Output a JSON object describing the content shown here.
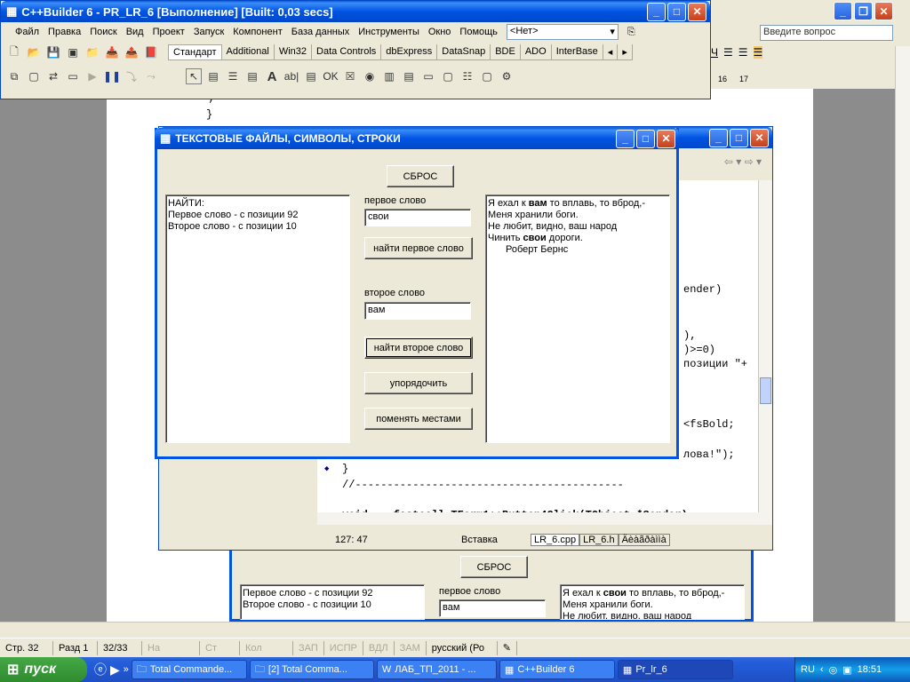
{
  "builder": {
    "title": "C++Builder 6 - PR_LR_6 [Выполнение] [Built: 0,03 secs]",
    "menu": [
      "Файл",
      "Правка",
      "Поиск",
      "Вид",
      "Проект",
      "Запуск",
      "Компонент",
      "База данных",
      "Инструменты",
      "Окно",
      "Помощь"
    ],
    "combo_value": "<Нет>",
    "palette_tabs": [
      "Стандарт",
      "Additional",
      "Win32",
      "Data Controls",
      "dbExpress",
      "DataSnap",
      "BDE",
      "ADO",
      "InterBase"
    ]
  },
  "word": {
    "help_placeholder": "Введите вопрос",
    "font_size_a": "16",
    "font_size_b": "17",
    "code_frag": ";",
    "status": {
      "page": "Стр. 32",
      "section": "Разд 1",
      "pages": "32/33",
      "at": "На",
      "line": "Ст",
      "col": "Кол",
      "rec": "ЗАП",
      "trk": "ИСПР",
      "ext": "ВДЛ",
      "ovr": "ЗАМ",
      "lang": "русский (Ро"
    }
  },
  "editor": {
    "code_lines": [
      "ender)",
      "),",
      ")>=0)",
      "позиции \"+",
      "<fsBold;",
      "лова!\");",
      "}",
      "//------------------------------------------",
      "void  __fastcall TForm1::Button4Click(TObject *Sender)"
    ],
    "cursor_pos": "127:  47",
    "insert_mode": "Вставка",
    "tabs": [
      "LR_6.cpp",
      "LR_6.h",
      "Äèàãðàììà"
    ]
  },
  "form": {
    "title": "ТЕКСТОВЫЕ ФАЙЛЫ, СИМВОЛЫ, СТРОКИ",
    "reset_label": "СБРОС",
    "result_lines": [
      "НАЙТИ:",
      "Первое слово - с позиции 92",
      "Второе слово - с позиции 10"
    ],
    "first_word_label": "первое слово",
    "first_word_value": "свои",
    "find_first_label": "найти первое слово",
    "second_word_label": "второе слово",
    "second_word_value": "вам",
    "find_second_label": "найти второе слово",
    "sort_label": "упорядочить",
    "swap_label": "поменять местами",
    "poem": {
      "l1_a": "Я ехал к ",
      "l1_b": "вам",
      "l1_c": " то вплавь, то вброд,-",
      "l2": "Меня хранили боги.",
      "l3": "Не любит, видно, ваш народ",
      "l4_a": "Чинить ",
      "l4_b": "свои",
      "l4_c": " дороги.",
      "l5": "Роберт Бернс"
    }
  },
  "form2": {
    "reset_label": "СБРОС",
    "result_lines": [
      "Первое слово - с позиции 92",
      "Второе слово - с позиции 10"
    ],
    "first_word_label": "первое слово",
    "first_word_value": "вам",
    "poem_l1_a": "Я ехал к ",
    "poem_l1_b": "свои",
    "poem_l1_c": " то вплавь, то вброд,-",
    "poem_l2": "Меня хранили боги.",
    "poem_l3": "Не любит, видно, ваш народ"
  },
  "taskbar": {
    "start": "пуск",
    "items": [
      "Total Commande...",
      "[2] Total Comma...",
      "ЛАБ_ТП_2011 - ...",
      "C++Builder 6",
      "Pr_lr_6"
    ],
    "lang": "RU",
    "clock": "18:51"
  },
  "colors": {
    "xp_blue": "#0054e3",
    "face": "#ece9d8",
    "taskbar": "#245edb",
    "start_green": "#3c9c3c"
  }
}
